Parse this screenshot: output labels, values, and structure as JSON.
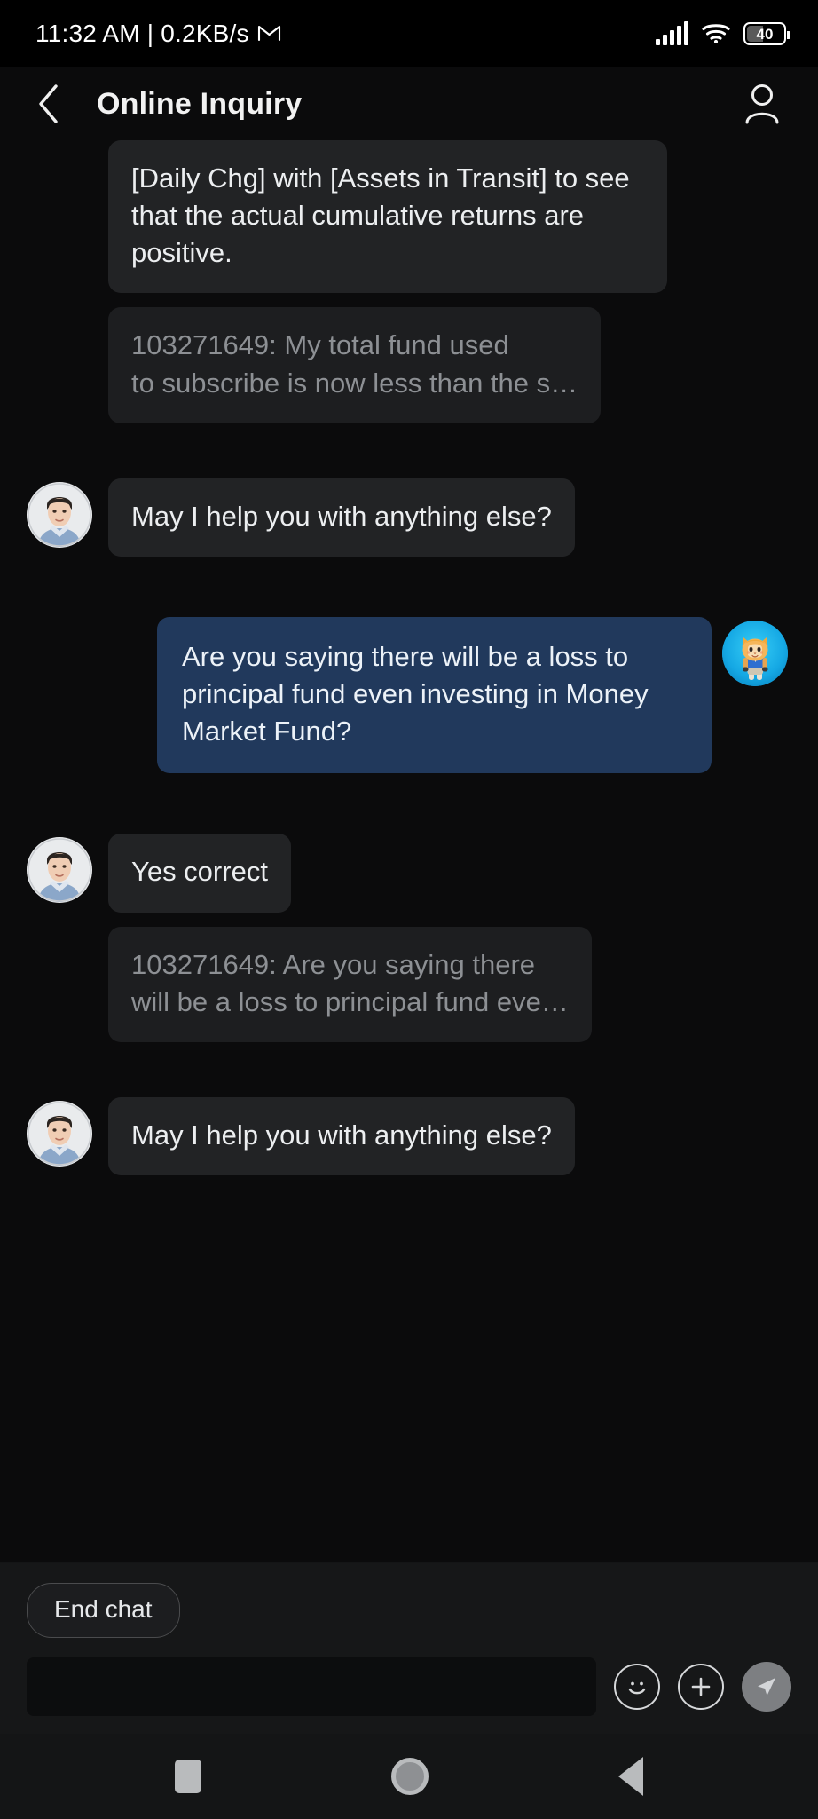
{
  "status_bar": {
    "time_and_speed": "11:32 AM | 0.2KB/s",
    "gmail_icon": "gmail-icon",
    "signal_icon": "signal-bars-icon",
    "wifi_icon": "wifi-icon",
    "battery_level": "40",
    "battery_icon": "battery-icon"
  },
  "header": {
    "back_icon": "back-chevron-icon",
    "title": "Online Inquiry",
    "profile_icon": "person-icon"
  },
  "messages": [
    {
      "id": "m1",
      "sender": "agent",
      "type": "bubble",
      "show_avatar": false,
      "text": "[Daily Chg] with [Assets in Transit] to see that the actual cumulative returns are positive."
    },
    {
      "id": "m2",
      "sender": "system",
      "type": "quote",
      "line1": "103271649: My total fund used",
      "line2": "to subscribe is now less than the s…"
    },
    {
      "id": "m3",
      "sender": "agent",
      "type": "bubble",
      "show_avatar": true,
      "text": "May I help you with anything else?"
    },
    {
      "id": "m4",
      "sender": "user",
      "type": "bubble",
      "show_avatar": true,
      "text": "Are you saying there will be a loss to principal fund even investing in Money Market Fund?"
    },
    {
      "id": "m5",
      "sender": "agent",
      "type": "bubble",
      "show_avatar": true,
      "text": "Yes correct"
    },
    {
      "id": "m6",
      "sender": "system",
      "type": "quote",
      "line1": "103271649: Are you saying there",
      "line2": "will be a loss to principal fund eve…"
    },
    {
      "id": "m7",
      "sender": "agent",
      "type": "bubble",
      "show_avatar": true,
      "text": "May I help you with anything else?"
    }
  ],
  "composer": {
    "end_chat_label": "End chat",
    "input_value": "",
    "input_placeholder": "",
    "emoji_icon": "smiley-icon",
    "attach_icon": "plus-icon",
    "send_icon": "send-paper-plane-icon"
  },
  "nav_bar": {
    "recents_icon": "square-recents-icon",
    "home_icon": "circle-home-icon",
    "back_icon": "triangle-back-icon"
  },
  "colors": {
    "background": "#0b0b0c",
    "agent_bubble": "#222325",
    "quote_bubble": "#1d1e20",
    "user_bubble": "#21395c",
    "quote_text": "#8d9094",
    "composer_bg": "#161718"
  }
}
